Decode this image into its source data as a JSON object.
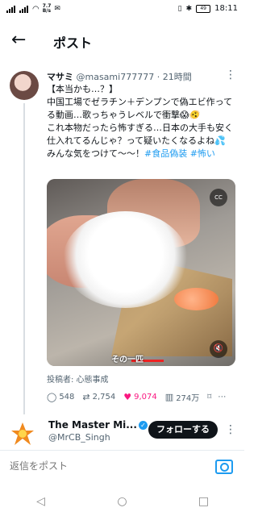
{
  "status": {
    "speed_up": "7.7",
    "speed_unit": "B/s",
    "battery": "49",
    "time": "18:11"
  },
  "header": {
    "back_icon": "arrow-left-icon",
    "title": "ポスト"
  },
  "tweet": {
    "author_name": "マサミ",
    "author_handle": "@masami777777",
    "time_ago": "· 21時間",
    "more_icon": "more-vertical-icon",
    "lines": [
      "【本当かも…？】",
      "中国工場でゼラチン＋デンプンで偽エビ作ってる動画…歌っちゃうレベルで衝撃😱🫨",
      "これ本物だったら怖すぎる…日本の大手も安く仕入れてるんじゃ？って疑いたくなるよね💦",
      "みんな気をつけて〜〜！"
    ],
    "hashtags": [
      "#食品偽装",
      "#怖い"
    ],
    "media": {
      "overlay_text": "その一匹",
      "cc_icon": "captions-icon",
      "mute_icon": "volume-mute-icon"
    },
    "source_label": "投稿者: 心態事成",
    "actions": {
      "replies": "548",
      "retweets": "2,754",
      "likes": "9,074",
      "views": "274万"
    }
  },
  "recommend": {
    "name": "The Master Mi...",
    "handle": "@MrCB_Singh",
    "follow_label": "フォローする"
  },
  "reply_box": {
    "placeholder": "返信をポスト"
  },
  "colors": {
    "accent": "#1d9bf0",
    "like": "#f91880",
    "text": "#0f1419",
    "muted": "#536471"
  }
}
